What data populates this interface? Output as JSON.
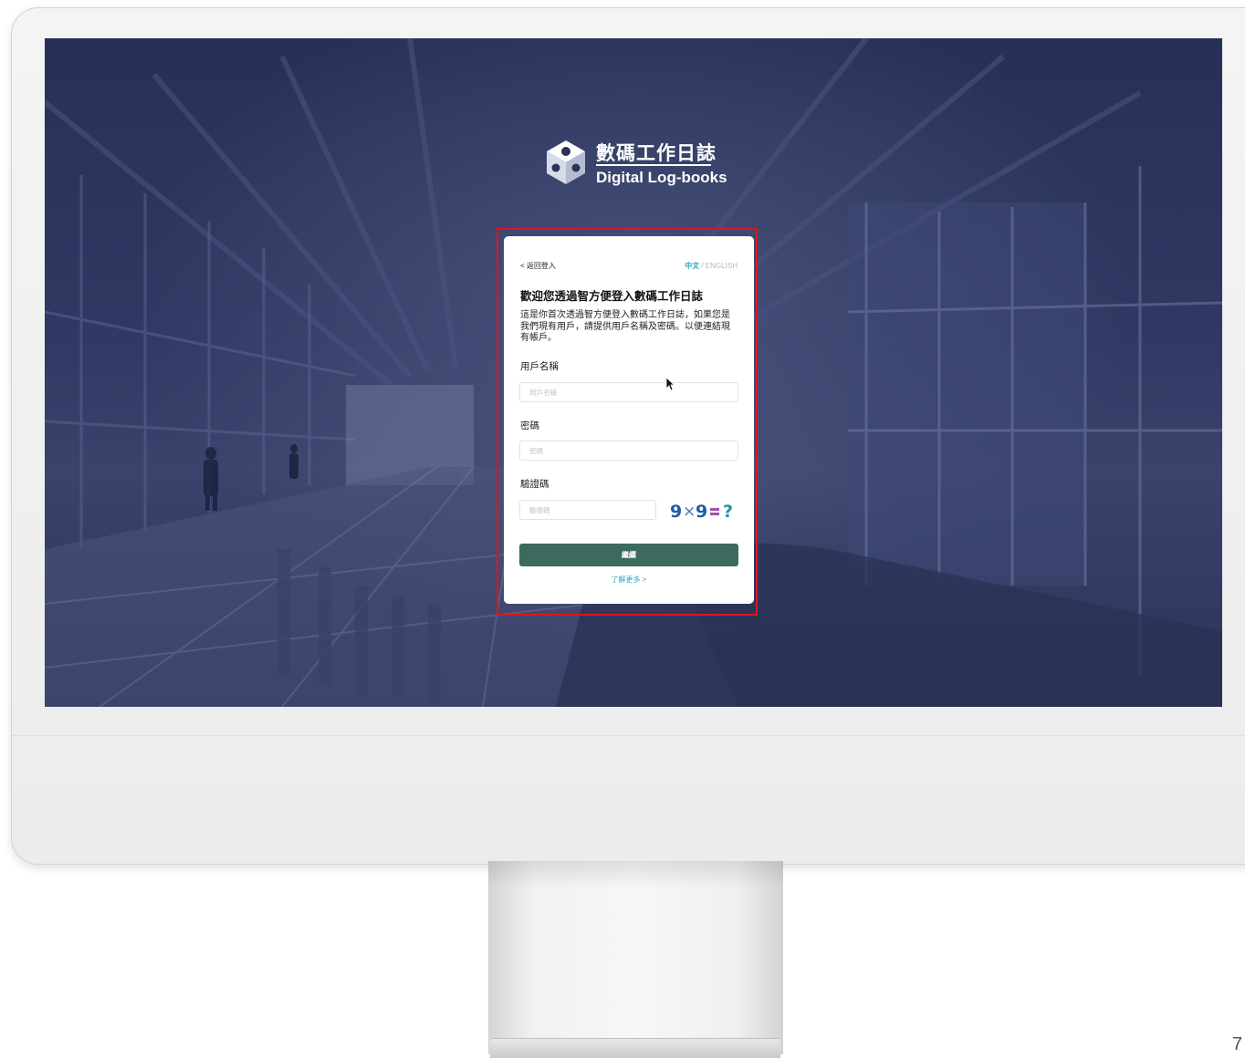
{
  "logo": {
    "title_zh": "數碼工作日誌",
    "title_en": "Digital Log-books"
  },
  "card": {
    "back_label": "< 返回登入",
    "lang_zh": "中文",
    "lang_sep": " / ",
    "lang_en": "ENGLISH",
    "title": "歡迎您透過智方便登入數碼工作日誌",
    "description": "這是你首次透過智方便登入數碼工作日誌，如果您是我們現有用戶，請提供用戶名稱及密碼。以便連結現有帳戶。",
    "username": {
      "label": "用戶名稱",
      "placeholder": "用戶名稱",
      "value": ""
    },
    "password": {
      "label": "密碼",
      "placeholder": "密碼",
      "value": ""
    },
    "captcha": {
      "label": "驗證碼",
      "placeholder": "驗證碼",
      "value": "",
      "image_text": "9×9=?"
    },
    "submit_label": "繼續",
    "learn_more": "了解更多 >"
  },
  "page_number": "7",
  "colors": {
    "accent_teal": "#2ea3b8",
    "button_green": "#3c6a5e",
    "highlight_red": "#e0141c",
    "background_navy": "#2a3259"
  }
}
